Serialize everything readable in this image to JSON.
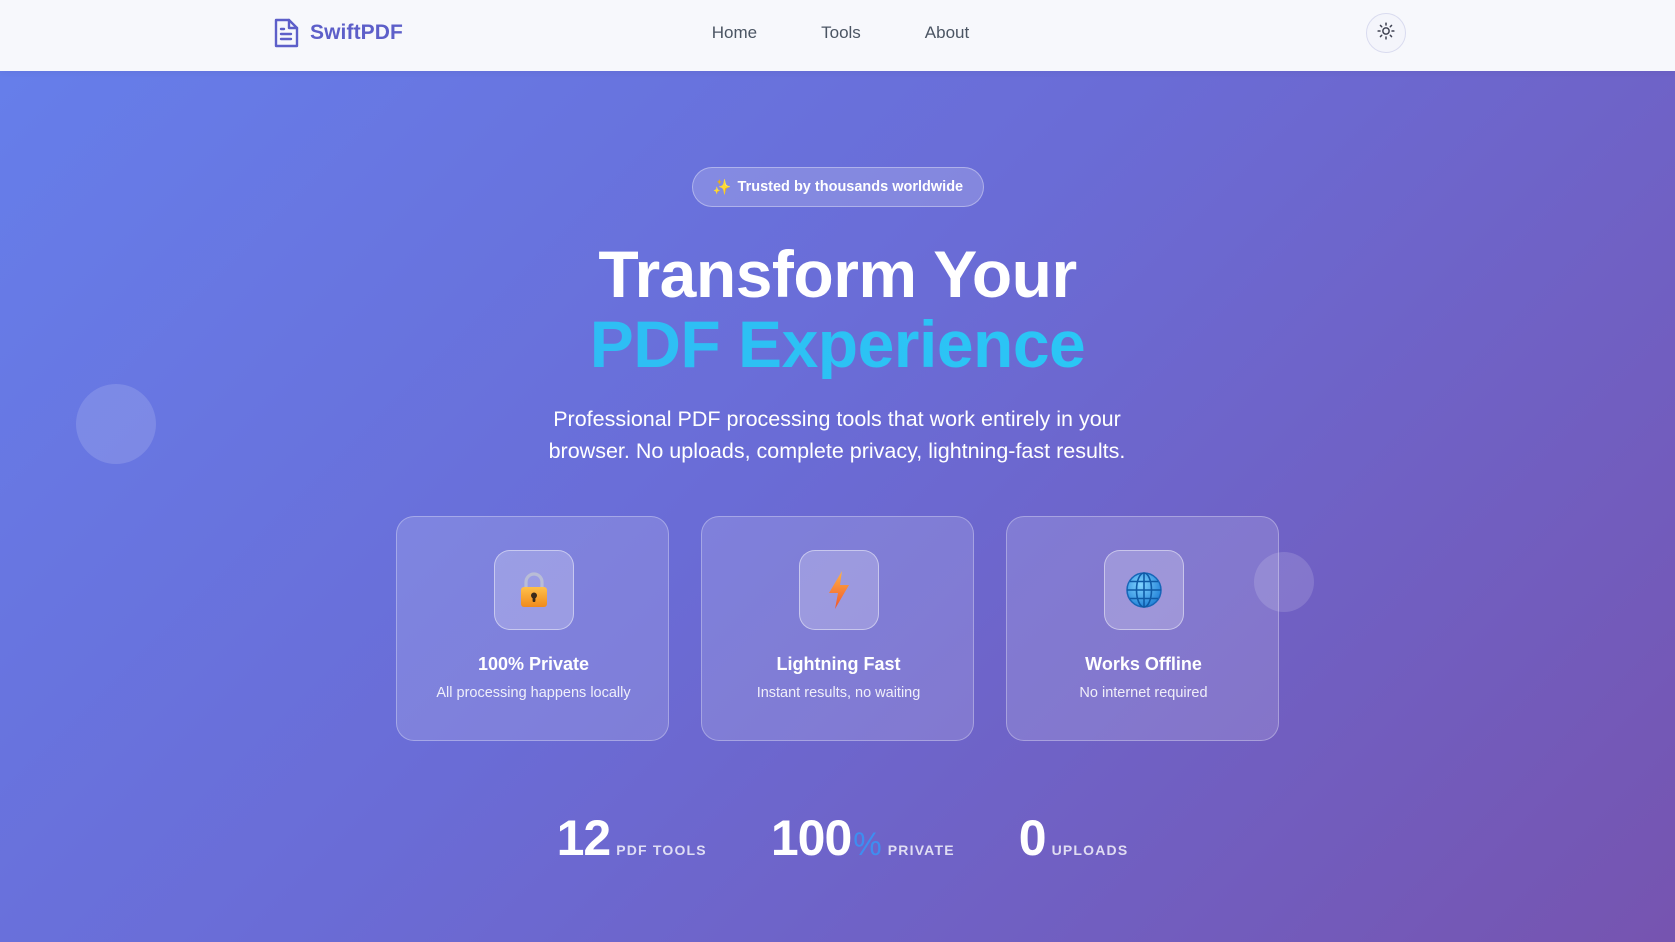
{
  "header": {
    "brand": "SwiftPDF",
    "nav": [
      "Home",
      "Tools",
      "About"
    ],
    "theme_toggle_icon": "sun-icon"
  },
  "hero": {
    "badge_icon": "sparkles-icon",
    "badge": "Trusted by thousands worldwide",
    "title_line1": "Transform Your",
    "title_line2": "PDF Experience",
    "subtitle_line1": "Professional PDF processing tools that work entirely in your",
    "subtitle_line2": "browser. No uploads, complete privacy, lightning-fast results.",
    "features": [
      {
        "icon": "lock-icon",
        "title": "100% Private",
        "desc": "All processing happens locally"
      },
      {
        "icon": "lightning-icon",
        "title": "Lightning Fast",
        "desc": "Instant results, no waiting"
      },
      {
        "icon": "globe-icon",
        "title": "Works Offline",
        "desc": "No internet required"
      }
    ],
    "stats": [
      {
        "value": "12",
        "suffix": "",
        "label": "PDF Tools"
      },
      {
        "value": "100",
        "suffix": "%",
        "label": "Private"
      },
      {
        "value": "0",
        "suffix": "",
        "label": "Uploads"
      }
    ]
  },
  "colors": {
    "brand": "#5d5fc9",
    "gradient_start": "#667eea",
    "gradient_end": "#7654b0",
    "accent_cyan": "#26d0f7",
    "percent_blue": "#3e8ef0"
  }
}
